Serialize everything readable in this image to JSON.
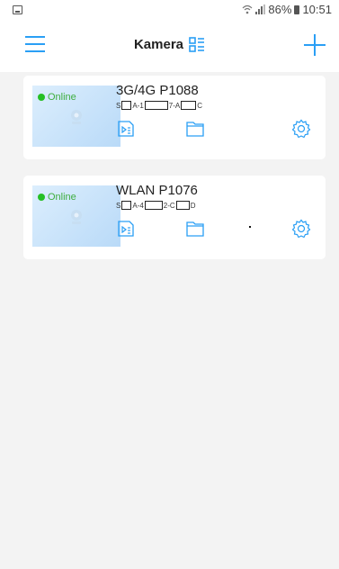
{
  "statusbar": {
    "battery": "86%",
    "time": "10:51",
    "icons": [
      "notification-icon",
      "wifi-icon",
      "signal-icon",
      "battery-icon"
    ]
  },
  "header": {
    "title": "Kamera",
    "menu_icon": "menu-icon",
    "view_icon": "grid-list-icon",
    "add_icon": "plus-icon"
  },
  "colors": {
    "accent": "#2a9ff5",
    "online": "#25c025",
    "background": "#f3f3f3"
  },
  "cameras": [
    {
      "status": "Online",
      "name": "3G/4G P1088",
      "serial_parts": [
        "S",
        "A-1",
        "7-A",
        "C"
      ]
    },
    {
      "status": "Online",
      "name": "WLAN P1076",
      "serial_parts": [
        "S",
        "A-4",
        "2-C",
        "D"
      ]
    }
  ]
}
